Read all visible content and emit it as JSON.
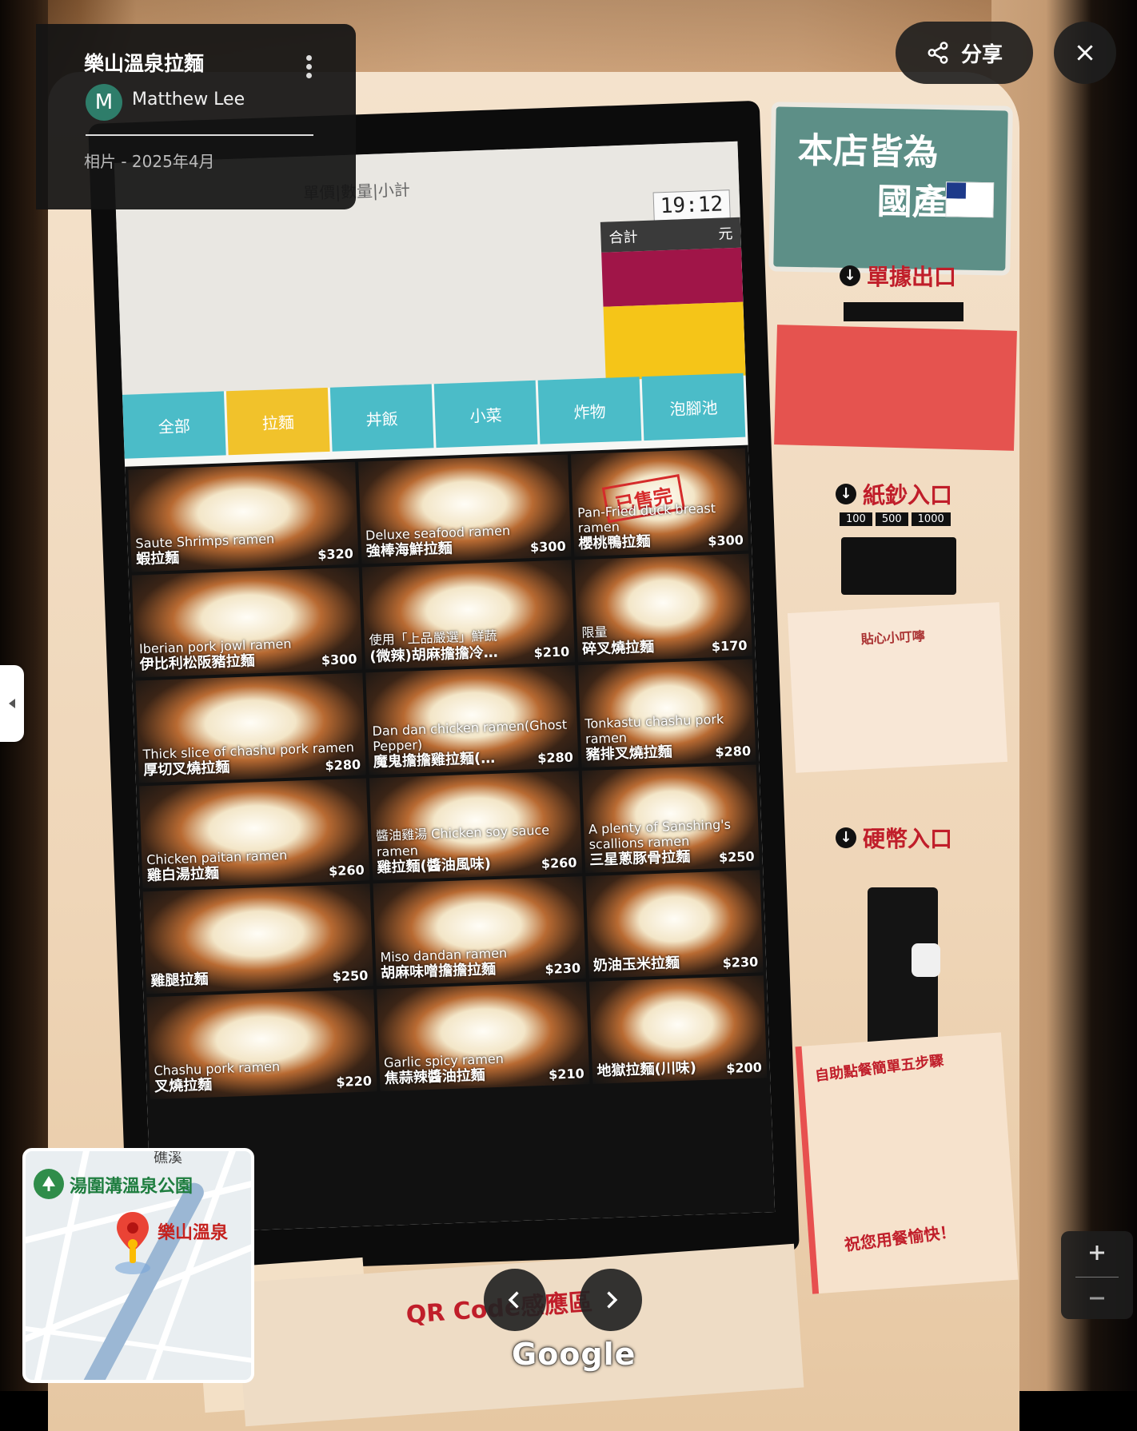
{
  "overlay": {
    "title": "樂山溫泉拉麵",
    "author_initial": "M",
    "author_name": "Matthew Lee",
    "meta": "相片 - 2025年4月",
    "share_label": "分享",
    "google_label": "Google"
  },
  "map": {
    "top_label": "礁溪",
    "park_label": "湯圍溝溫泉公園",
    "place_label": "樂山溫泉"
  },
  "machine": {
    "sign_line1": "本店皆為",
    "sign_line2": "國產",
    "receipt_label": "單據出口",
    "bill_label": "紙鈔入口",
    "bills": [
      "100",
      "500",
      "1000"
    ],
    "coin_label": "硬幣入口",
    "qr_label": "QR Code感應區",
    "notice_title": "貼心小叮嚀",
    "steps_title": "自助點餐簡單五步驟",
    "steps_footer": "祝您用餐愉快！"
  },
  "screen": {
    "header": "單價|數量|小計",
    "time": "19:12",
    "total_label": "合計",
    "currency": "元",
    "tabs": [
      {
        "label": "全部"
      },
      {
        "label": "拉麵",
        "active": true
      },
      {
        "label": "丼飯"
      },
      {
        "label": "小菜"
      },
      {
        "label": "炸物"
      },
      {
        "label": "泡腳池"
      }
    ],
    "items": [
      {
        "en": "Saute Shrimps ramen",
        "zh": "蝦拉麵",
        "price": "$320"
      },
      {
        "en": "Deluxe seafood ramen",
        "zh": "強棒海鮮拉麵",
        "price": "$300"
      },
      {
        "en": "Pan-Fried duck breast ramen",
        "zh": "櫻桃鴨拉麵",
        "price": "$300",
        "sold_out": "已售完"
      },
      {
        "en": "Iberian pork jowl ramen",
        "zh": "伊比利松阪豬拉麵",
        "price": "$300"
      },
      {
        "en": "使用「上品嚴選」鮮蔬",
        "zh": "(微辣)胡麻擔擔冷…",
        "price": "$210"
      },
      {
        "en": "限量",
        "zh": "碎叉燒拉麵",
        "price": "$170"
      },
      {
        "en": "Thick slice of chashu pork ramen",
        "zh": "厚切叉燒拉麵",
        "price": "$280"
      },
      {
        "en": "Dan dan chicken ramen(Ghost Pepper)",
        "zh": "魔鬼擔擔雞拉麵(…",
        "price": "$280"
      },
      {
        "en": "Tonkastu chashu pork ramen",
        "zh": "豬排叉燒拉麵",
        "price": "$280"
      },
      {
        "en": "Chicken paitan ramen",
        "zh": "雞白湯拉麵",
        "price": "$260"
      },
      {
        "en": "醬油雞湯 Chicken soy sauce ramen",
        "zh": "雞拉麵(醬油風味)",
        "price": "$260"
      },
      {
        "en": "A plenty of Sanshing's scallions ramen",
        "zh": "三星蔥豚骨拉麵",
        "price": "$250"
      },
      {
        "en": "",
        "zh": "雞腿拉麵",
        "price": "$250"
      },
      {
        "en": "Miso dandan ramen",
        "zh": "胡麻味噌擔擔拉麵",
        "price": "$230"
      },
      {
        "en": "",
        "zh": "奶油玉米拉麵",
        "price": "$230"
      },
      {
        "en": "Chashu pork ramen",
        "zh": "叉燒拉麵",
        "price": "$220"
      },
      {
        "en": "Garlic spicy ramen",
        "zh": "焦蒜辣醬油拉麵",
        "price": "$210"
      },
      {
        "en": "",
        "zh": "地獄拉麵(川味)",
        "price": "$200"
      }
    ]
  },
  "icons": {
    "share": "share-icon",
    "close": "close-icon",
    "more": "more-vert-icon",
    "prev": "chevron-left-icon",
    "next": "chevron-right-icon",
    "zoom_in": "plus-icon",
    "zoom_out": "minus-icon",
    "collapse": "caret-left-icon",
    "park": "park-icon",
    "pin": "map-pin-icon"
  },
  "colors": {
    "tab_teal": "#4bbcc8",
    "tab_active_yellow": "#f1c22b",
    "panel_red": "#a01548",
    "panel_yellow": "#f5c518",
    "sign_green": "#5d8f87",
    "label_red": "#c01e2a"
  }
}
